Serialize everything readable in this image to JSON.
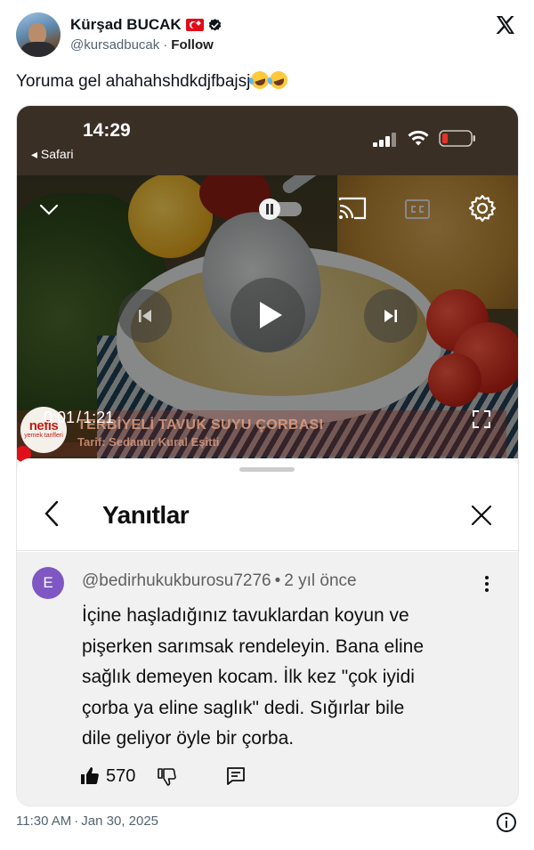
{
  "tweet": {
    "display_name": "Kürşad BUCAK",
    "flag": "Turkey flag",
    "handle": "@kursadbucak",
    "separator": "·",
    "follow_label": "Follow",
    "text": "Yoruma gel ahahahshdkdjfbajsj",
    "emoji": "rolling-on-floor-laughing",
    "time": "11:30 AM",
    "date": "Jan 30, 2025",
    "footer_separator": "·"
  },
  "phone": {
    "clock": "14:29",
    "back_app": "◂ Safari",
    "battery_color": "#e5332a"
  },
  "video": {
    "current_time": "0:01",
    "time_separator": "/",
    "duration": "1:21",
    "brand": "nefis",
    "brand_sub": "yemek tarifleri",
    "recipe_title": "TERBİYELİ TAVUK SUYU ÇORBASI",
    "recipe_by": "Tarif: Sedanur Kural Eşitti",
    "progress": 0.012,
    "progress_color": "#e0101b"
  },
  "replies": {
    "title": "Yanıtlar",
    "comment": {
      "avatar_letter": "E",
      "avatar_color": "#7e57c2",
      "author": "@bedirhukukburosu7276",
      "meta_separator": "•",
      "age": "2 yıl önce",
      "lines": [
        "İçine haşladığınız tavuklardan koyun ve",
        "pişerken sarımsak rendeleyin. Bana eline",
        "sağlık demeyen kocam. İlk kez \"çok iyidi",
        "çorba ya eline saglık\" dedi. Sığırlar bile",
        "dile geliyor öyle bir çorba."
      ],
      "likes": "570"
    }
  },
  "colors": {
    "text_primary": "#0f1419",
    "text_secondary": "#536471",
    "comment_bg": "#f1f1f1"
  }
}
